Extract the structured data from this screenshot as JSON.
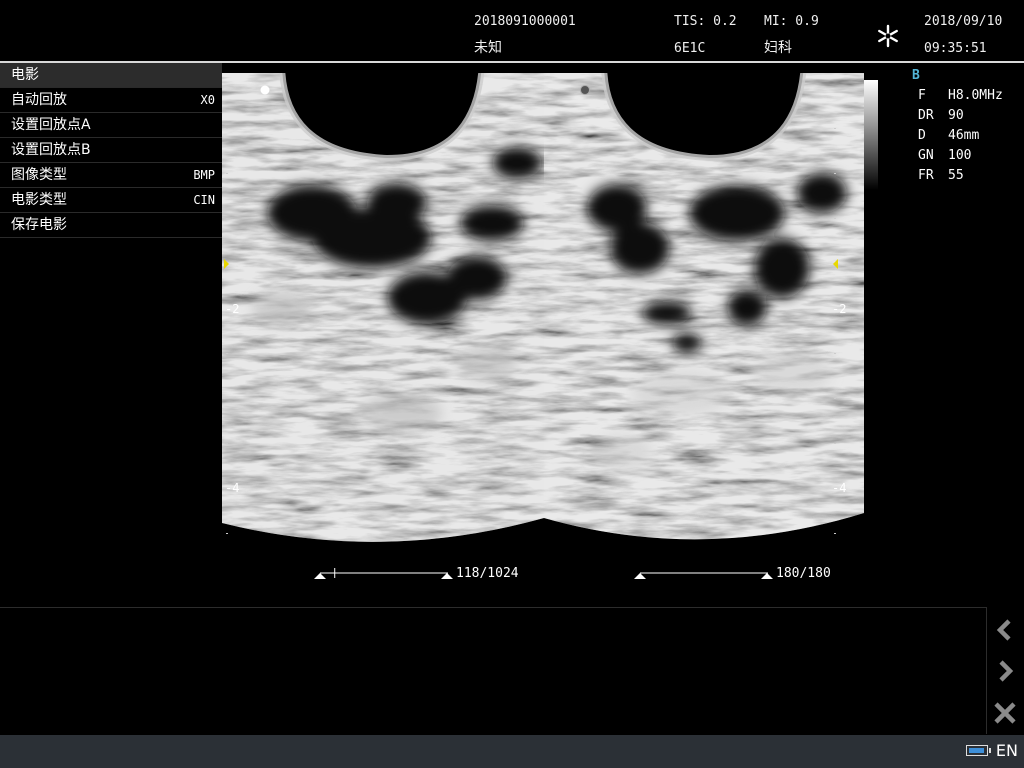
{
  "header": {
    "patient_id": "2018091000001",
    "patient_name": "未知",
    "tis": "TIS: 0.2",
    "probe": "6E1C",
    "mi": "MI: 0.9",
    "exam_type": "妇科",
    "freeze_icon": "snowflake-icon",
    "date": "2018/09/10",
    "time": "09:35:51"
  },
  "menu": {
    "title": "电影",
    "items": [
      {
        "label": "自动回放",
        "value": "X0"
      },
      {
        "label": "设置回放点A",
        "value": ""
      },
      {
        "label": "设置回放点B",
        "value": ""
      },
      {
        "label": "图像类型",
        "value": "BMP"
      },
      {
        "label": "电影类型",
        "value": "CIN"
      },
      {
        "label": "保存电影",
        "value": ""
      }
    ]
  },
  "params": {
    "mode": "B",
    "rows": [
      {
        "key": "F",
        "value": "H8.0MHz"
      },
      {
        "key": "DR",
        "value": "90"
      },
      {
        "key": "D",
        "value": "46mm"
      },
      {
        "key": "GN",
        "value": "100"
      },
      {
        "key": "FR",
        "value": "55"
      }
    ]
  },
  "depth_labels": {
    "left": [
      "-2",
      "-4"
    ],
    "right": [
      "-2",
      "-4"
    ]
  },
  "cine": {
    "left_counter": "118/1024",
    "left_position_fraction": 0.115,
    "right_counter": "180/180"
  },
  "nav": {
    "prev_icon": "chevron-left-icon",
    "next_icon": "chevron-right-icon",
    "close_icon": "close-icon"
  },
  "status": {
    "language": "EN",
    "battery_icon": "battery-icon",
    "battery_color": "#3e8fd8"
  }
}
